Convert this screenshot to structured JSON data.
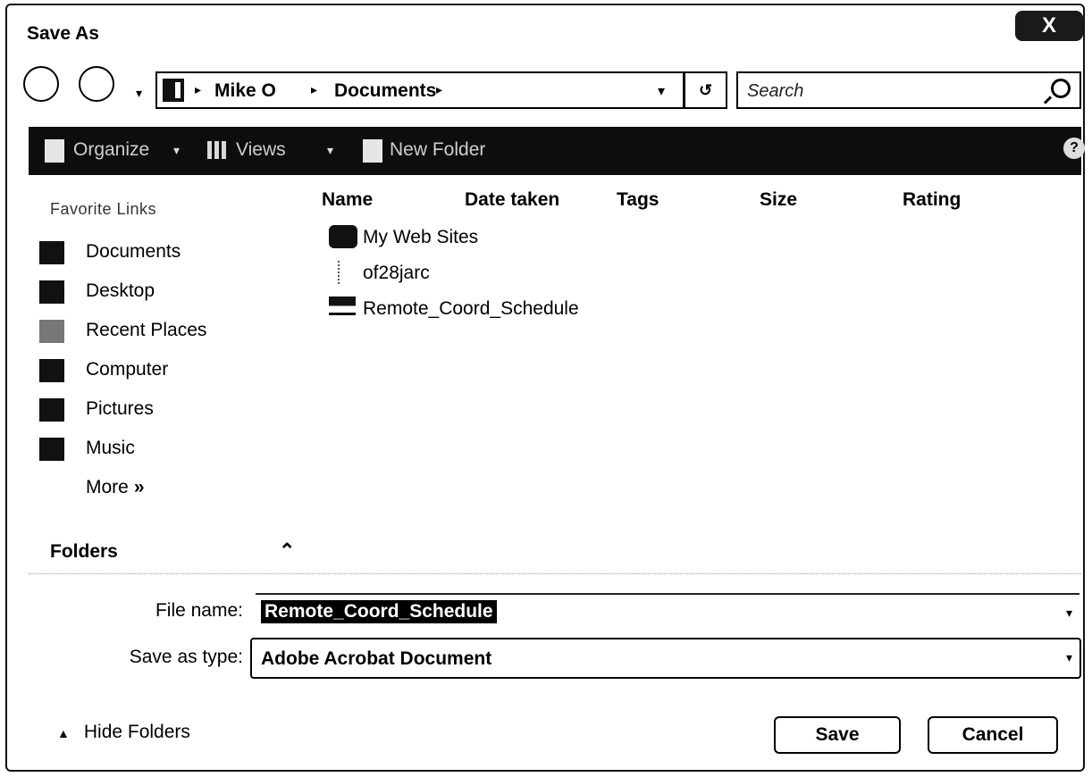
{
  "window": {
    "title": "Save As",
    "close_label": "X"
  },
  "nav": {
    "dropdown_glyph": "▾"
  },
  "address": {
    "crumbs": [
      "Mike O",
      "Documents"
    ],
    "separator": "▸",
    "dropdown_glyph": "▾",
    "refresh_glyph": "↺"
  },
  "search": {
    "placeholder": "Search"
  },
  "toolbar": {
    "organize": "Organize",
    "views": "Views",
    "new_folder": "New Folder",
    "caret": "▾",
    "help": "?"
  },
  "favorites": {
    "header": "Favorite Links",
    "items": [
      {
        "label": "Documents",
        "icon": "documents-icon"
      },
      {
        "label": "Desktop",
        "icon": "desktop-icon"
      },
      {
        "label": "Recent Places",
        "icon": "recent-places-icon"
      },
      {
        "label": "Computer",
        "icon": "computer-icon"
      },
      {
        "label": "Pictures",
        "icon": "pictures-icon"
      },
      {
        "label": "Music",
        "icon": "music-icon"
      }
    ],
    "more": "More",
    "more_chevron": "»"
  },
  "columns": [
    "Name",
    "Date taken",
    "Tags",
    "Size",
    "Rating"
  ],
  "files": [
    {
      "name": "My Web Sites",
      "icon": "web-folder-icon"
    },
    {
      "name": "of28jarc",
      "icon": "file-icon"
    },
    {
      "name": "Remote_Coord_Schedule",
      "icon": "pdf-file-icon"
    }
  ],
  "folders": {
    "label": "Folders",
    "caret": "⌃"
  },
  "form": {
    "file_name_label": "File name:",
    "file_name_value": "Remote_Coord_Schedule",
    "save_type_label": "Save as type:",
    "save_type_value": "Adobe Acrobat Document",
    "dropdown_glyph": "▾"
  },
  "footer": {
    "hide_folders": "Hide Folders",
    "hide_glyph": "▲",
    "save": "Save",
    "cancel": "Cancel"
  }
}
